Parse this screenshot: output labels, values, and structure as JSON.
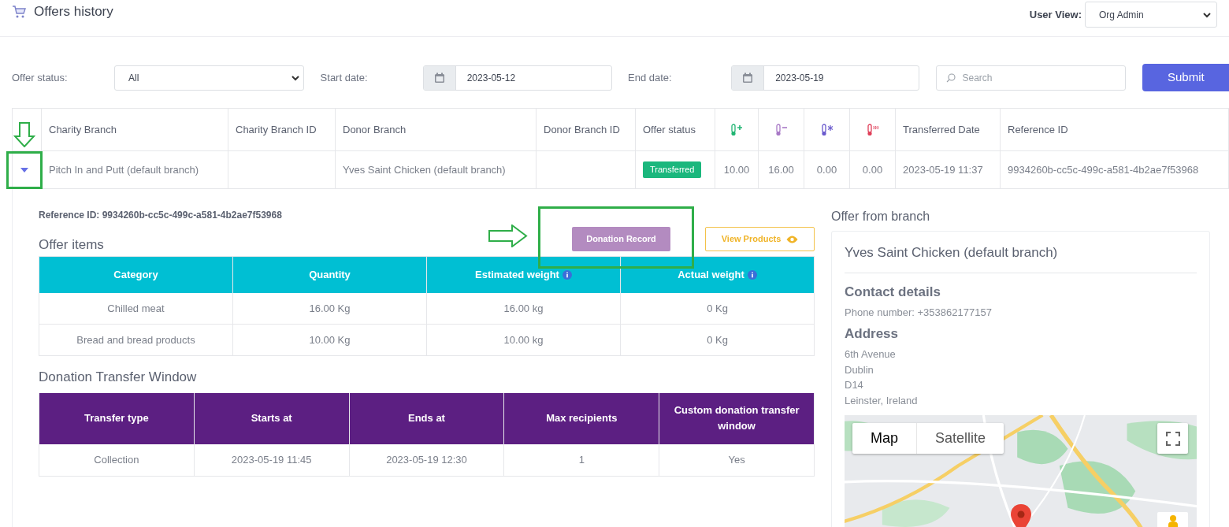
{
  "header": {
    "title": "Offers history",
    "user_view": {
      "label": "User View:",
      "value": "Org Admin"
    }
  },
  "filters": {
    "offer_status": {
      "label": "Offer status:",
      "value": "All"
    },
    "start_date": {
      "label": "Start date:",
      "value": "2023-05-12"
    },
    "end_date": {
      "label": "End date:",
      "value": "2023-05-19"
    },
    "search": {
      "placeholder": "Search"
    },
    "submit": "Submit"
  },
  "offers_table": {
    "columns": [
      {
        "kind": "expander"
      },
      {
        "kind": "text",
        "label": "Charity Branch"
      },
      {
        "kind": "text",
        "label": "Charity Branch ID"
      },
      {
        "kind": "text",
        "label": "Donor Branch"
      },
      {
        "kind": "text",
        "label": "Donor Branch ID"
      },
      {
        "kind": "text",
        "label": "Offer status"
      },
      {
        "kind": "icon"
      },
      {
        "kind": "icon"
      },
      {
        "kind": "icon"
      },
      {
        "kind": "icon"
      },
      {
        "kind": "text",
        "label": "Transferred Date"
      },
      {
        "kind": "text",
        "label": "Reference ID"
      }
    ],
    "rows": [
      {
        "expanded": true,
        "charity_branch": "Pitch In and Putt (default branch)",
        "donor_branch": "Yves Saint Chicken (default branch)",
        "status": "Transferred",
        "temps": [
          "10.00",
          "16.00",
          "0.00",
          "0.00"
        ],
        "transferred_date": "2023-05-19 11:37",
        "reference_id": "9934260b-cc5c-499c-a581-4b2ae7f53968"
      }
    ]
  },
  "detail": {
    "reference_id": "Reference ID: 9934260b-cc5c-499c-a581-4b2ae7f53968",
    "offer_items": {
      "title": "Offer items",
      "columns": [
        {
          "label": "Category",
          "info": false
        },
        {
          "label": "Quantity",
          "info": false
        },
        {
          "label": "Estimated weight",
          "info": true
        },
        {
          "label": "Actual weight",
          "info": true
        }
      ],
      "rows": [
        [
          "Chilled meat",
          "16.00 Kg",
          "16.00 kg",
          "0 Kg"
        ],
        [
          "Bread and bread products",
          "10.00 Kg",
          "10.00 kg",
          "0 Kg"
        ]
      ]
    },
    "donation_record": "Donation Record",
    "view_products": "View Products",
    "transfer_window": {
      "title": "Donation Transfer Window",
      "columns": [
        "Transfer type",
        "Starts at",
        "Ends at",
        "Max recipients",
        "Custom donation transfer window"
      ],
      "rows": [
        [
          "Collection",
          "2023-05-19 11:45",
          "2023-05-19 12:30",
          "1",
          "Yes"
        ]
      ]
    }
  },
  "branch": {
    "section_title": "Offer from branch",
    "name": "Yves Saint Chicken (default branch)",
    "contact_title": "Contact details",
    "phone": "Phone number: +353862177157",
    "address_title": "Address",
    "address_lines": [
      "6th Avenue",
      "Dublin",
      "D14",
      "Leinster, Ireland"
    ],
    "map": {
      "kind": "picture",
      "types": [
        {
          "label": "Map",
          "selected": true
        },
        {
          "label": "Satellite",
          "selected": false
        }
      ]
    }
  }
}
